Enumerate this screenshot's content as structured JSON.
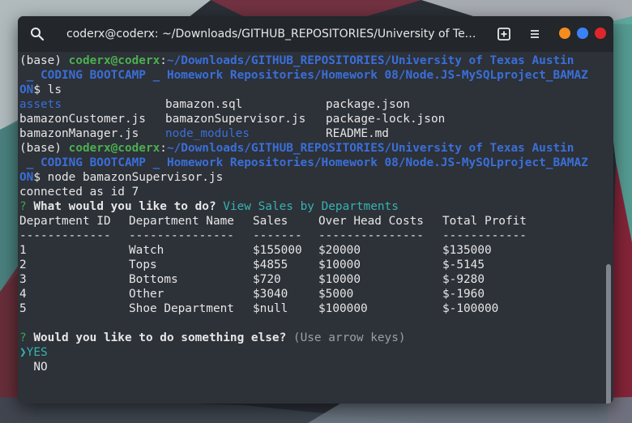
{
  "window": {
    "title": "coderx@coderx: ~/Downloads/GITHUB_REPOSITORIES/University of Texa...",
    "controls": {
      "minimize_color": "#f58b1f",
      "maximize_color": "#3b82f6",
      "close_color": "#e0262a"
    }
  },
  "prompt": {
    "base": "(base) ",
    "user_host": "coderx@coderx",
    "colon": ":",
    "path_line1": "~/Downloads/GITHUB_REPOSITORIES/University of Texas Austin",
    "path_line2": " _ CODING BOOTCAMP _ Homework Repositories/Homework 08/Node.JS-MySQLproject_BAMAZ",
    "path_line3": "ON",
    "dollar": "$ "
  },
  "commands": {
    "ls": "ls",
    "node": "node bamazonSupervisor.js"
  },
  "ls_output": [
    [
      "assets",
      "bamazon.sql",
      "package.json"
    ],
    [
      "bamazonCustomer.js",
      "bamazonSupervisor.js",
      "package-lock.json"
    ],
    [
      "bamazonManager.js",
      "node_modules",
      "README.md"
    ]
  ],
  "connected": "connected as id 7",
  "question1": {
    "mark": "?",
    "text": "What would you like to do?",
    "answer": "View Sales by Departments"
  },
  "table": {
    "headers": [
      "Department ID",
      "Department Name",
      "Sales",
      "Over Head Costs",
      "Total Profit"
    ],
    "separators": [
      "-------------",
      "---------------",
      "-------",
      "---------------",
      "------------"
    ],
    "rows": [
      [
        "1",
        "Watch",
        "$155000",
        "$20000",
        "$135000"
      ],
      [
        "2",
        "Tops",
        "$4855",
        "$10000",
        "$-5145"
      ],
      [
        "3",
        "Bottoms",
        "$720",
        "$10000",
        "$-9280"
      ],
      [
        "4",
        "Other",
        "$3040",
        "$5000",
        "$-1960"
      ],
      [
        "5",
        "Shoe Department",
        "$null",
        "$100000",
        "$-100000"
      ]
    ]
  },
  "question2": {
    "mark": "?",
    "text": "Would you like to do something else?",
    "hint": "(Use arrow keys)"
  },
  "choices": {
    "pointer": "❯",
    "selected": "YES",
    "other": "NO"
  },
  "icons": {
    "search": "search-icon",
    "new_tab": "new-tab-icon",
    "menu": "hamburger-menu-icon"
  }
}
